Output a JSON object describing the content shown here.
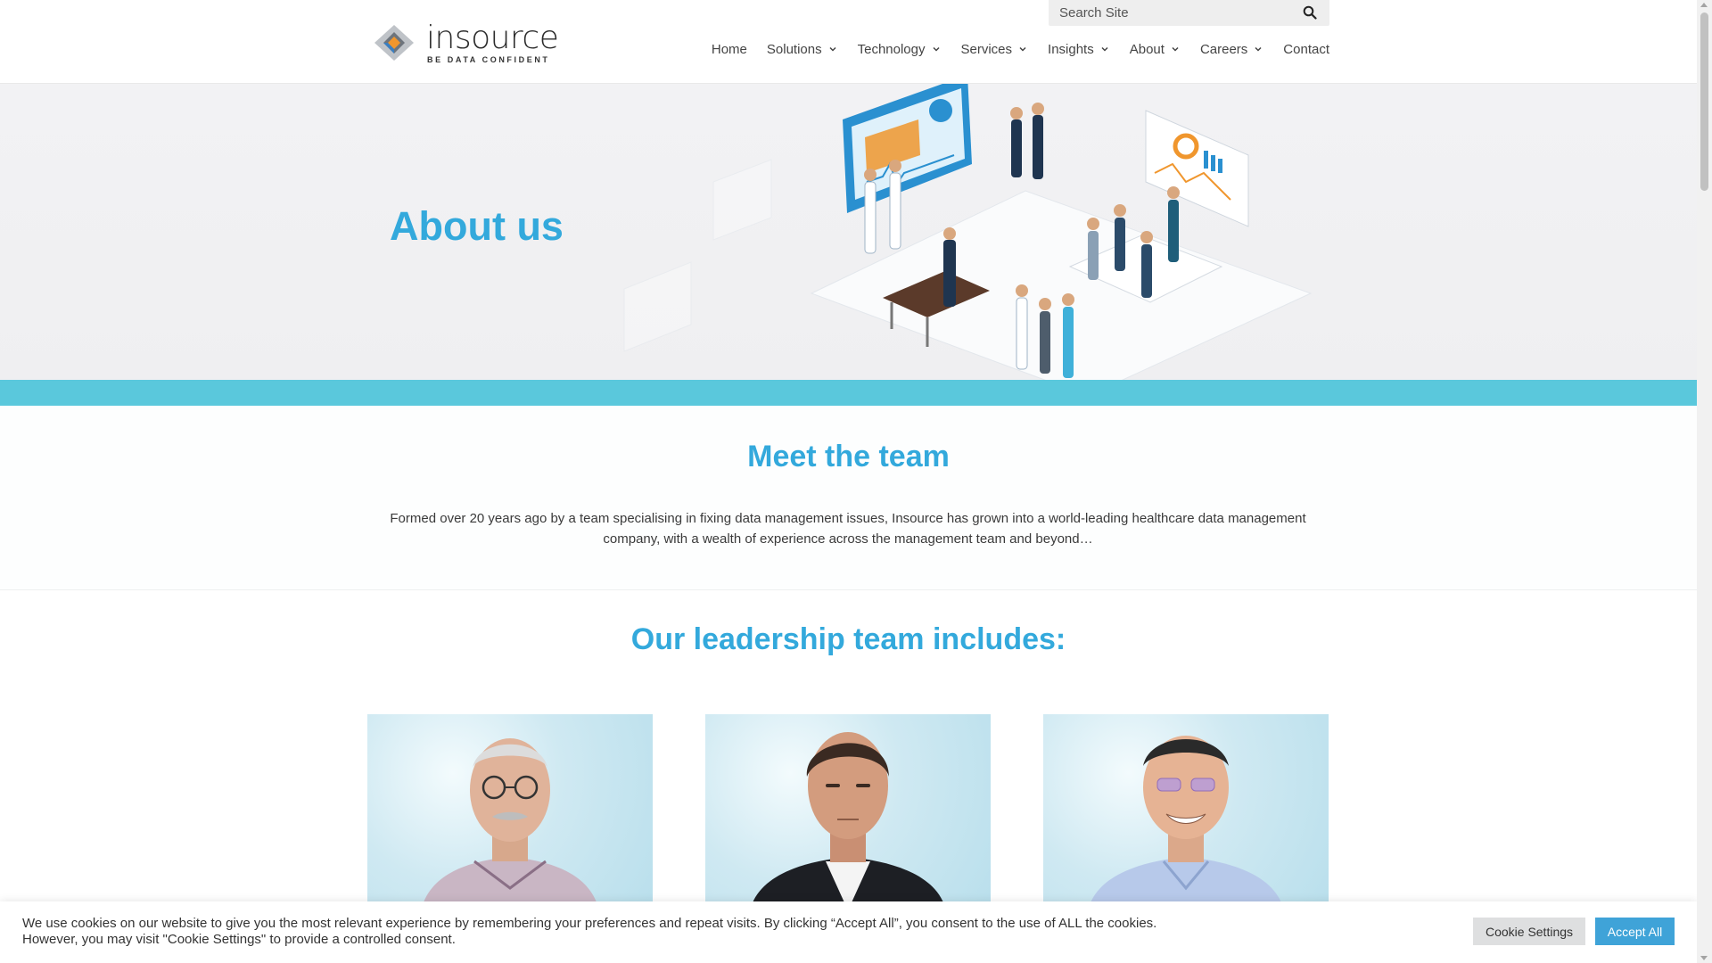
{
  "brand": {
    "name": "insource",
    "tagline": "BE DATA CONFIDENT",
    "colors": {
      "accent_blue": "#33a9dc",
      "teal_band": "#5ac8dc",
      "logo_orange": "#f0962d",
      "logo_blue": "#3a7fc1"
    }
  },
  "search": {
    "placeholder": "Search Site",
    "icon": "search-icon"
  },
  "nav": {
    "items": [
      {
        "label": "Home",
        "has_dropdown": false
      },
      {
        "label": "Solutions",
        "has_dropdown": true
      },
      {
        "label": "Technology",
        "has_dropdown": true
      },
      {
        "label": "Services",
        "has_dropdown": true
      },
      {
        "label": "Insights",
        "has_dropdown": true
      },
      {
        "label": "About",
        "has_dropdown": true
      },
      {
        "label": "Careers",
        "has_dropdown": true
      },
      {
        "label": "Contact",
        "has_dropdown": false
      }
    ]
  },
  "hero": {
    "title": "About us"
  },
  "meet": {
    "heading": "Meet the team",
    "body": "Formed over 20 years ago by a team specialising in fixing data management issues, Insource has grown into a world-leading healthcare data management company, with a wealth of experience across the management team and beyond…"
  },
  "leadership": {
    "heading": "Our leadership team includes:"
  },
  "cookie": {
    "text": "We use cookies on our website to give you the most relevant experience by remembering your preferences and repeat visits. By clicking “Accept All”, you consent to the use of ALL the cookies. However, you may visit \"Cookie Settings\" to provide a controlled consent.",
    "settings_label": "Cookie Settings",
    "accept_label": "Accept All"
  }
}
